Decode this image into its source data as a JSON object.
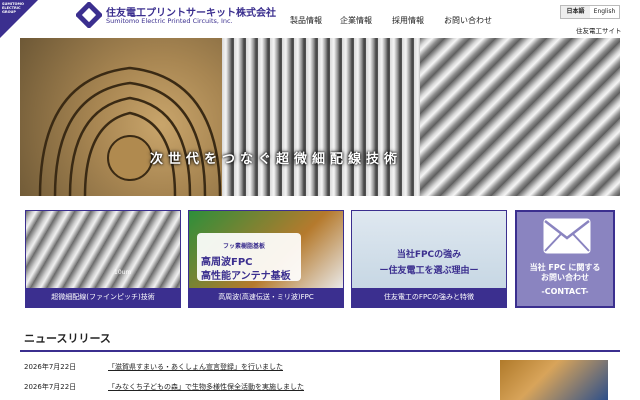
{
  "header": {
    "group_badge": "SUMITOMO ELECTRIC GROUP",
    "company_jp": "住友電工プリントサーキット株式会社",
    "company_en": "Sumitomo Electric Printed Circuits, Inc.",
    "nav": [
      "製品情報",
      "企業情報",
      "採用情報",
      "お問い合わせ"
    ],
    "lang": [
      "日本語",
      "English"
    ],
    "sei_link": "住友電工サイト"
  },
  "hero": {
    "caption": "次世代をつなぐ超微細配線技術"
  },
  "cards": [
    {
      "label": "超微細配線(ファインピッチ)技術",
      "dim": "10um"
    },
    {
      "tag": "フッ素樹脂基板",
      "line1": "高周波FPC",
      "line2": "高性能アンテナ基板",
      "label": "高周波(高速伝送・ミリ波)FPC"
    },
    {
      "line1": "当社FPCの強み",
      "line2": "ー住友電工を選ぶ理由ー",
      "label": "住友電工のFPCの強みと特徴"
    }
  ],
  "contact": {
    "line1": "当社 FPC に関する",
    "line2": "お問い合わせ",
    "line3": "-CONTACT-"
  },
  "news": {
    "title": "ニュースリリース",
    "items": [
      {
        "date": "2026年7月22日",
        "text": "「滋賀県すまいる・あくしょん宣言登録」を行いました"
      },
      {
        "date": "2026年7月22日",
        "text": "「みなくち子どもの森」で生物多様性保全活動を実施しました"
      }
    ]
  },
  "colors": {
    "brand": "#3b2f8f",
    "contact_bg": "#8a84c0"
  }
}
